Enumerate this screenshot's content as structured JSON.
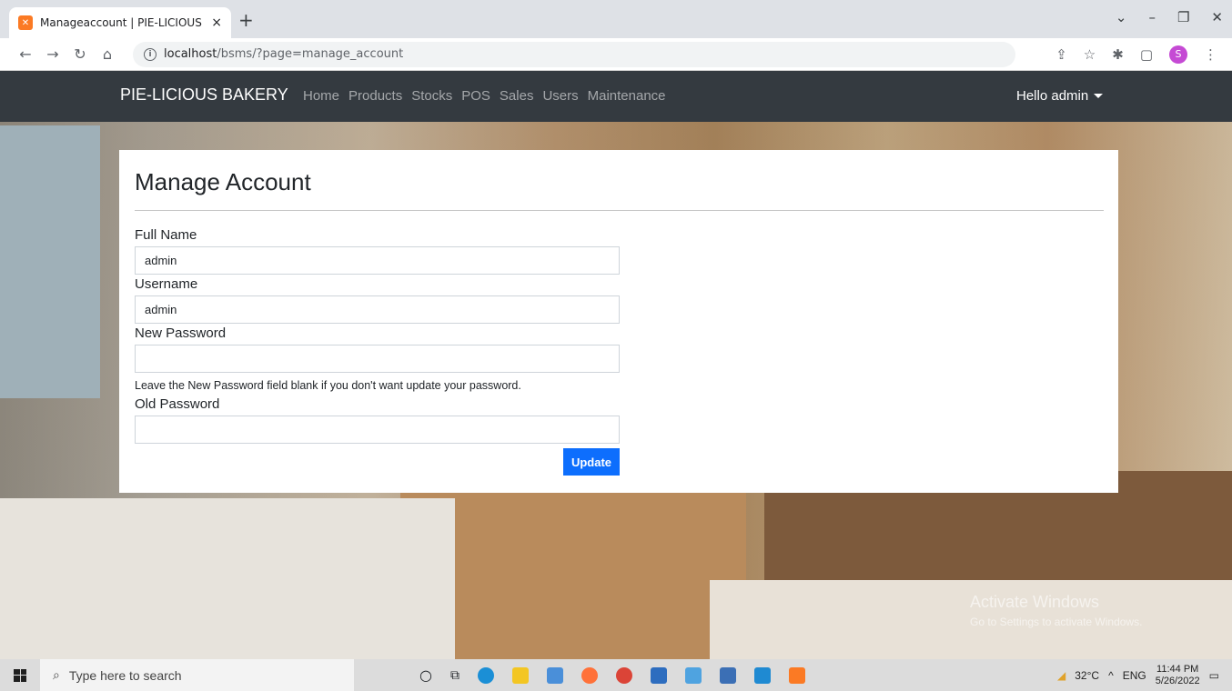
{
  "browser": {
    "tab_title": "Manageaccount | PIE-LICIOUS BAKERY",
    "tab_close": "×",
    "new_tab": "+",
    "url_host": "localhost",
    "url_path": "/bsms/?page=manage_account",
    "favicon": "xampp-icon",
    "profile_initial": "S",
    "window_controls": [
      "⌄",
      "–",
      "❐",
      "✕"
    ]
  },
  "navbar": {
    "brand": "PIE-LICIOUS BAKERY",
    "links": [
      "Home",
      "Products",
      "Stocks",
      "POS",
      "Sales",
      "Users",
      "Maintenance"
    ],
    "user_greeting": "Hello admin"
  },
  "form": {
    "title": "Manage Account",
    "fields": [
      {
        "label": "Full Name",
        "value": "admin"
      },
      {
        "label": "Username",
        "value": "admin"
      },
      {
        "label": "New Password",
        "value": ""
      },
      {
        "label": "Old Password",
        "value": ""
      }
    ],
    "help_text": "Leave the New Password field blank if you don't want update your password.",
    "submit_label": "Update"
  },
  "watermark": {
    "line1": "Activate Windows",
    "line2": "Go to Settings to activate Windows."
  },
  "taskbar": {
    "search_placeholder": "Type here to search",
    "weather": "32°C",
    "lang": "ENG",
    "time": "11:44 PM",
    "date": "5/26/2022"
  },
  "colors": {
    "navbar": "#343a40",
    "primary": "#0d6efd",
    "accent_favicon": "#fb7a24"
  }
}
